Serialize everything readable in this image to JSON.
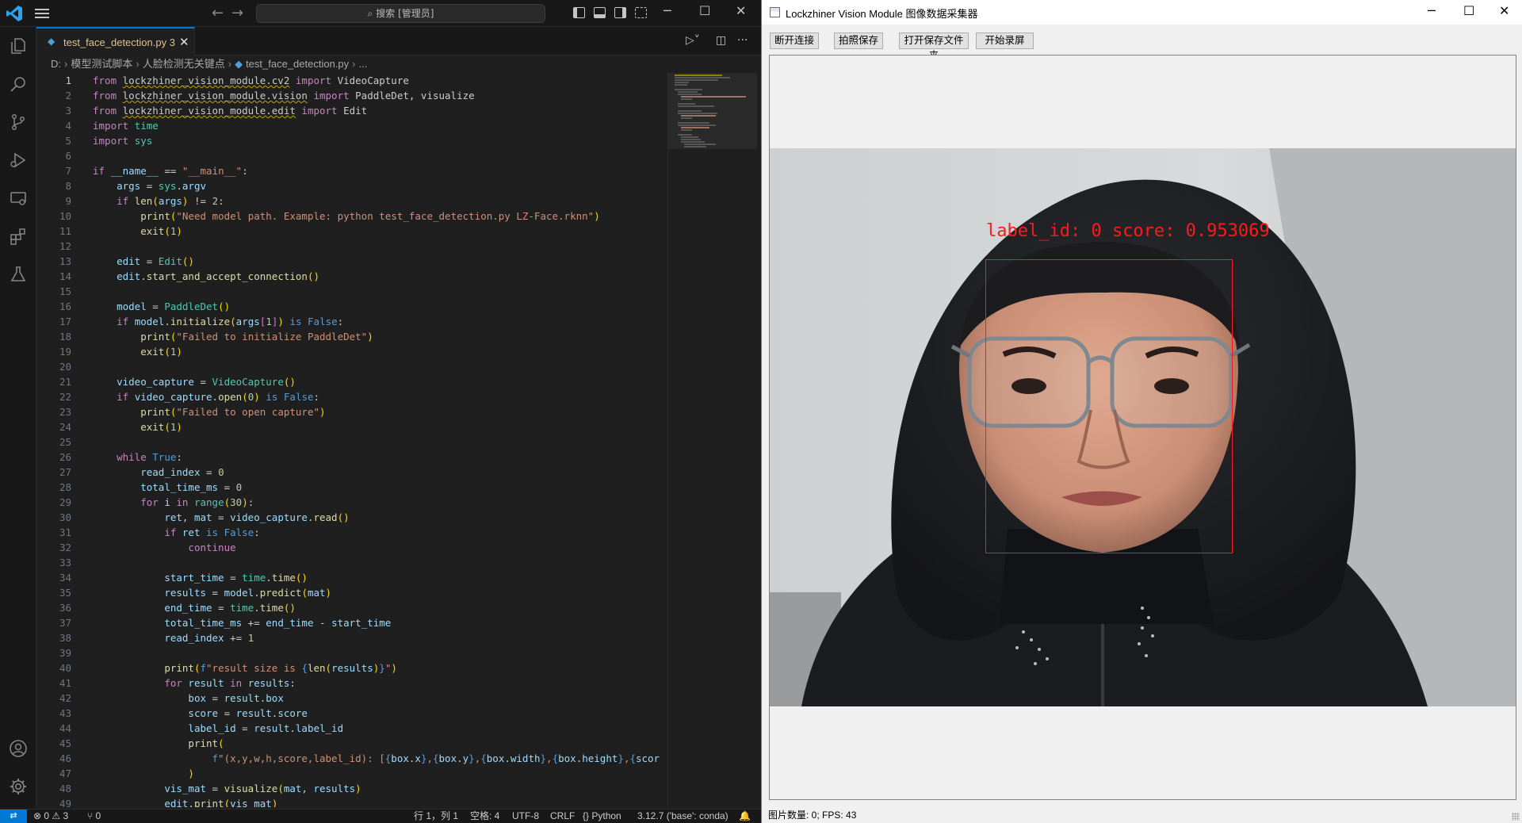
{
  "vscode": {
    "search_placeholder": "搜索 [管理员]",
    "tab": {
      "filename": "test_face_detection.py",
      "problems_count": "3"
    },
    "breadcrumb": {
      "drive": "D:",
      "folder1": "模型测试脚本",
      "folder2": "人脸检测无关键点",
      "file": "test_face_detection.py",
      "more": "..."
    },
    "code": [
      {
        "n": "1"
      },
      {
        "n": "2"
      },
      {
        "n": "3"
      },
      {
        "n": "4"
      },
      {
        "n": "5"
      },
      {
        "n": "6"
      },
      {
        "n": "7"
      },
      {
        "n": "8"
      },
      {
        "n": "9"
      },
      {
        "n": "10"
      },
      {
        "n": "11"
      },
      {
        "n": "12"
      },
      {
        "n": "13"
      },
      {
        "n": "14"
      },
      {
        "n": "15"
      },
      {
        "n": "16"
      },
      {
        "n": "17"
      },
      {
        "n": "18"
      },
      {
        "n": "19"
      },
      {
        "n": "20"
      },
      {
        "n": "21"
      },
      {
        "n": "22"
      },
      {
        "n": "23"
      },
      {
        "n": "24"
      },
      {
        "n": "25"
      },
      {
        "n": "26"
      },
      {
        "n": "27"
      },
      {
        "n": "28"
      },
      {
        "n": "29"
      },
      {
        "n": "30"
      },
      {
        "n": "31"
      },
      {
        "n": "32"
      },
      {
        "n": "33"
      },
      {
        "n": "34"
      },
      {
        "n": "35"
      },
      {
        "n": "36"
      },
      {
        "n": "37"
      },
      {
        "n": "38"
      },
      {
        "n": "39"
      },
      {
        "n": "40"
      },
      {
        "n": "41"
      },
      {
        "n": "42"
      },
      {
        "n": "43"
      },
      {
        "n": "44"
      },
      {
        "n": "45"
      },
      {
        "n": "46"
      },
      {
        "n": "47"
      },
      {
        "n": "48"
      },
      {
        "n": "49"
      }
    ],
    "status": {
      "errors": "0",
      "warnings": "3",
      "ports": "0",
      "position": "行 1，列 1",
      "spaces": "空格: 4",
      "encoding": "UTF-8",
      "eol": "CRLF",
      "language": "Python",
      "interpreter": "3.12.7 ('base': conda)"
    },
    "colors": {
      "accent": "#0078d4",
      "modified_tab": "#e2c08d"
    }
  },
  "qt_app": {
    "title": "Lockzhiner Vision Module 图像数据采集器",
    "buttons": {
      "disconnect": "断开连接",
      "capture_save": "拍照保存",
      "open_folder": "打开保存文件夹",
      "start_record": "开始录屏"
    },
    "detection_label": "label_id: 0 score: 0.953069",
    "status": "图片数量: 0; FPS: 43",
    "colors": {
      "detection": "#ff1a1a"
    }
  }
}
